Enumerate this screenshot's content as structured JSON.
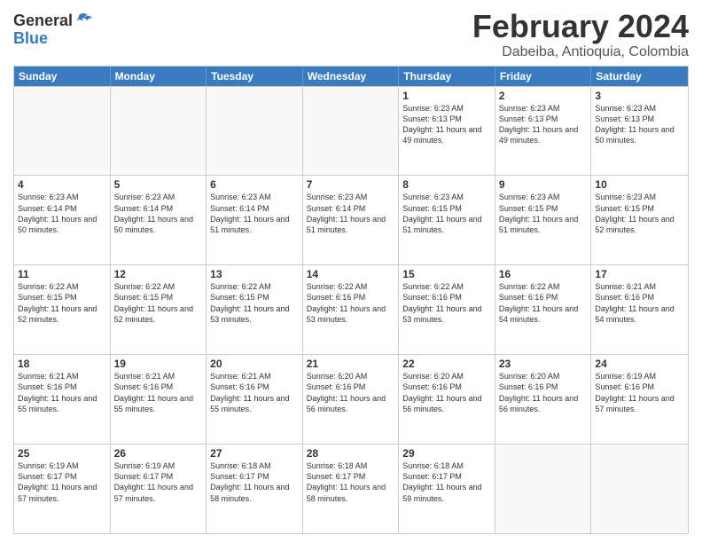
{
  "header": {
    "logo_general": "General",
    "logo_blue": "Blue",
    "month_title": "February 2024",
    "location": "Dabeiba, Antioquia, Colombia"
  },
  "days_of_week": [
    "Sunday",
    "Monday",
    "Tuesday",
    "Wednesday",
    "Thursday",
    "Friday",
    "Saturday"
  ],
  "weeks": [
    [
      {
        "day": "",
        "empty": true
      },
      {
        "day": "",
        "empty": true
      },
      {
        "day": "",
        "empty": true
      },
      {
        "day": "",
        "empty": true
      },
      {
        "day": "1",
        "sunrise": "6:23 AM",
        "sunset": "6:13 PM",
        "daylight": "11 hours and 49 minutes."
      },
      {
        "day": "2",
        "sunrise": "6:23 AM",
        "sunset": "6:13 PM",
        "daylight": "11 hours and 49 minutes."
      },
      {
        "day": "3",
        "sunrise": "6:23 AM",
        "sunset": "6:13 PM",
        "daylight": "11 hours and 50 minutes."
      }
    ],
    [
      {
        "day": "4",
        "sunrise": "6:23 AM",
        "sunset": "6:14 PM",
        "daylight": "11 hours and 50 minutes."
      },
      {
        "day": "5",
        "sunrise": "6:23 AM",
        "sunset": "6:14 PM",
        "daylight": "11 hours and 50 minutes."
      },
      {
        "day": "6",
        "sunrise": "6:23 AM",
        "sunset": "6:14 PM",
        "daylight": "11 hours and 51 minutes."
      },
      {
        "day": "7",
        "sunrise": "6:23 AM",
        "sunset": "6:14 PM",
        "daylight": "11 hours and 51 minutes."
      },
      {
        "day": "8",
        "sunrise": "6:23 AM",
        "sunset": "6:15 PM",
        "daylight": "11 hours and 51 minutes."
      },
      {
        "day": "9",
        "sunrise": "6:23 AM",
        "sunset": "6:15 PM",
        "daylight": "11 hours and 51 minutes."
      },
      {
        "day": "10",
        "sunrise": "6:23 AM",
        "sunset": "6:15 PM",
        "daylight": "11 hours and 52 minutes."
      }
    ],
    [
      {
        "day": "11",
        "sunrise": "6:22 AM",
        "sunset": "6:15 PM",
        "daylight": "11 hours and 52 minutes."
      },
      {
        "day": "12",
        "sunrise": "6:22 AM",
        "sunset": "6:15 PM",
        "daylight": "11 hours and 52 minutes."
      },
      {
        "day": "13",
        "sunrise": "6:22 AM",
        "sunset": "6:15 PM",
        "daylight": "11 hours and 53 minutes."
      },
      {
        "day": "14",
        "sunrise": "6:22 AM",
        "sunset": "6:16 PM",
        "daylight": "11 hours and 53 minutes."
      },
      {
        "day": "15",
        "sunrise": "6:22 AM",
        "sunset": "6:16 PM",
        "daylight": "11 hours and 53 minutes."
      },
      {
        "day": "16",
        "sunrise": "6:22 AM",
        "sunset": "6:16 PM",
        "daylight": "11 hours and 54 minutes."
      },
      {
        "day": "17",
        "sunrise": "6:21 AM",
        "sunset": "6:16 PM",
        "daylight": "11 hours and 54 minutes."
      }
    ],
    [
      {
        "day": "18",
        "sunrise": "6:21 AM",
        "sunset": "6:16 PM",
        "daylight": "11 hours and 55 minutes."
      },
      {
        "day": "19",
        "sunrise": "6:21 AM",
        "sunset": "6:16 PM",
        "daylight": "11 hours and 55 minutes."
      },
      {
        "day": "20",
        "sunrise": "6:21 AM",
        "sunset": "6:16 PM",
        "daylight": "11 hours and 55 minutes."
      },
      {
        "day": "21",
        "sunrise": "6:20 AM",
        "sunset": "6:16 PM",
        "daylight": "11 hours and 56 minutes."
      },
      {
        "day": "22",
        "sunrise": "6:20 AM",
        "sunset": "6:16 PM",
        "daylight": "11 hours and 56 minutes."
      },
      {
        "day": "23",
        "sunrise": "6:20 AM",
        "sunset": "6:16 PM",
        "daylight": "11 hours and 56 minutes."
      },
      {
        "day": "24",
        "sunrise": "6:19 AM",
        "sunset": "6:16 PM",
        "daylight": "11 hours and 57 minutes."
      }
    ],
    [
      {
        "day": "25",
        "sunrise": "6:19 AM",
        "sunset": "6:17 PM",
        "daylight": "11 hours and 57 minutes."
      },
      {
        "day": "26",
        "sunrise": "6:19 AM",
        "sunset": "6:17 PM",
        "daylight": "11 hours and 57 minutes."
      },
      {
        "day": "27",
        "sunrise": "6:18 AM",
        "sunset": "6:17 PM",
        "daylight": "11 hours and 58 minutes."
      },
      {
        "day": "28",
        "sunrise": "6:18 AM",
        "sunset": "6:17 PM",
        "daylight": "11 hours and 58 minutes."
      },
      {
        "day": "29",
        "sunrise": "6:18 AM",
        "sunset": "6:17 PM",
        "daylight": "11 hours and 59 minutes."
      },
      {
        "day": "",
        "empty": true
      },
      {
        "day": "",
        "empty": true
      }
    ]
  ]
}
